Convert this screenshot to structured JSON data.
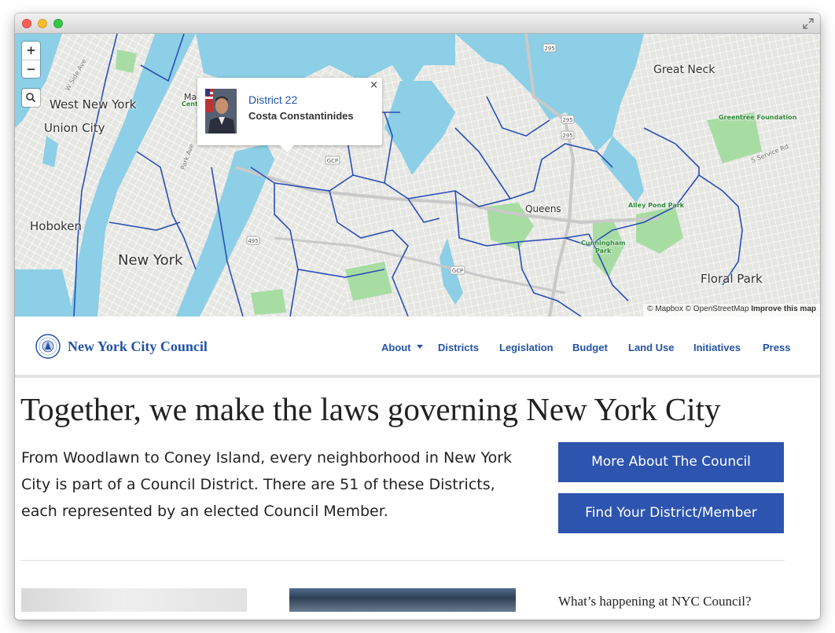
{
  "map": {
    "labels": {
      "west_new_york": "West New York",
      "union_city": "Union City",
      "hoboken": "Hoboken",
      "new_york": "New York",
      "queens": "Queens",
      "great_neck": "Great Neck",
      "floral_park": "Floral Park",
      "greentree": "Greentree Foundation",
      "alley_pond": "Alley Pond Park",
      "cunningham": "Cunningham",
      "cunningham_2": "Park",
      "service_rd": "S Service Rd",
      "park_ave": "Park Ave",
      "w_side_ave": "W Side Ave",
      "ma_partial": "Ma",
      "cent_partial": "Cent",
      "route_295a": "295",
      "route_295b": "295",
      "route_295c": "295",
      "route_495": "495",
      "gcp_a": "GCP",
      "gcp_b": "GCP"
    },
    "zoom_in": "+",
    "zoom_out": "−",
    "popup": {
      "district": "District 22",
      "member": "Costa Constantinides",
      "close": "×"
    },
    "attribution": {
      "mapbox": "© Mapbox",
      "osm": "© OpenStreetMap",
      "improve": "Improve this map"
    }
  },
  "header": {
    "logo": "New York City Council",
    "nav": [
      "About",
      "Districts",
      "Legislation",
      "Budget",
      "Land Use",
      "Initiatives",
      "Press"
    ]
  },
  "hero": {
    "headline": "Together, we make the laws governing New York City",
    "intro": "From Woodlawn to Coney Island, every neighborhood in New York City is part of a Council District. There are 51 of these Districts, each represented by an elected Council Member.",
    "button_more": "More About The Council",
    "button_find": "Find Your District/Member"
  },
  "sidebar": {
    "whats_happening": "What’s happening at NYC Council?"
  },
  "colors": {
    "brand_blue": "#2453a6",
    "button_blue": "#2d54ae",
    "water": "#8ccfe6",
    "park": "#a7dca3",
    "district_line": "#2a4fb5"
  }
}
